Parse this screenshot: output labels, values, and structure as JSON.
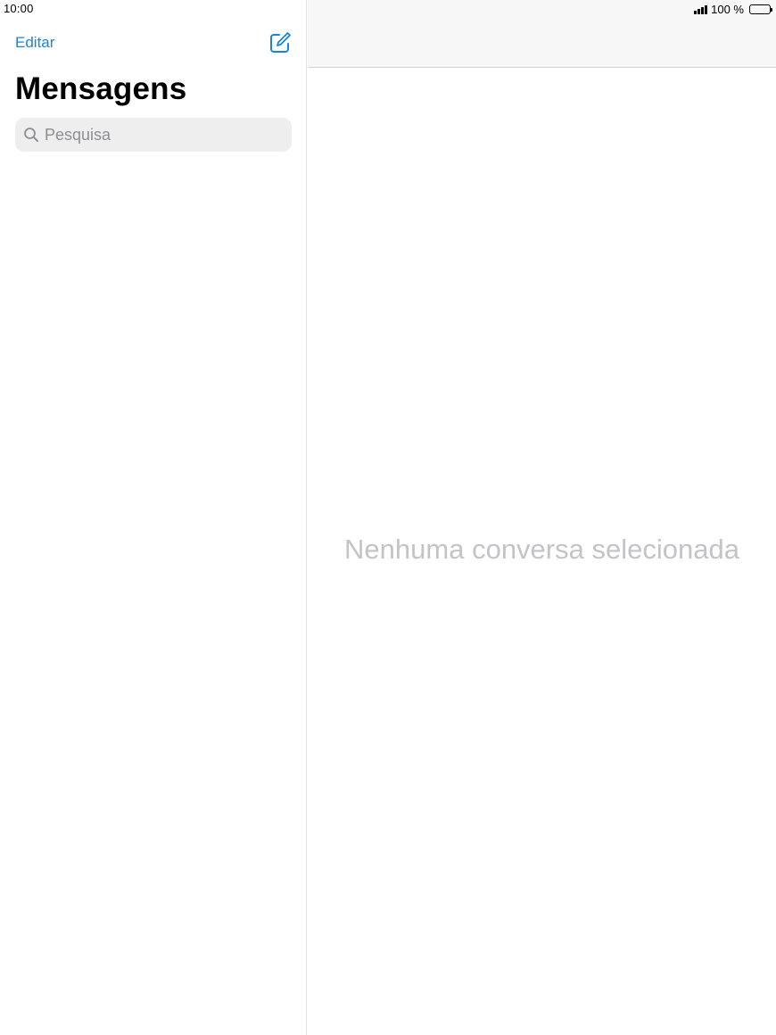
{
  "status_bar": {
    "time": "10:00",
    "battery_text": "100 %",
    "signal_icon": "signal-bars-icon",
    "battery_icon": "battery-full-icon"
  },
  "sidebar": {
    "edit_label": "Editar",
    "compose_icon": "compose-icon",
    "title": "Mensagens",
    "search": {
      "placeholder": "Pesquisa",
      "value": "",
      "icon": "search-icon"
    }
  },
  "detail": {
    "empty_message": "Nenhuma conversa selecionada"
  },
  "colors": {
    "accent": "#1a84d8",
    "placeholder": "#8e8e93",
    "empty_text": "#c4c4c7",
    "navbar_bg": "#f7f7f7",
    "search_bg": "#eeeeef"
  }
}
